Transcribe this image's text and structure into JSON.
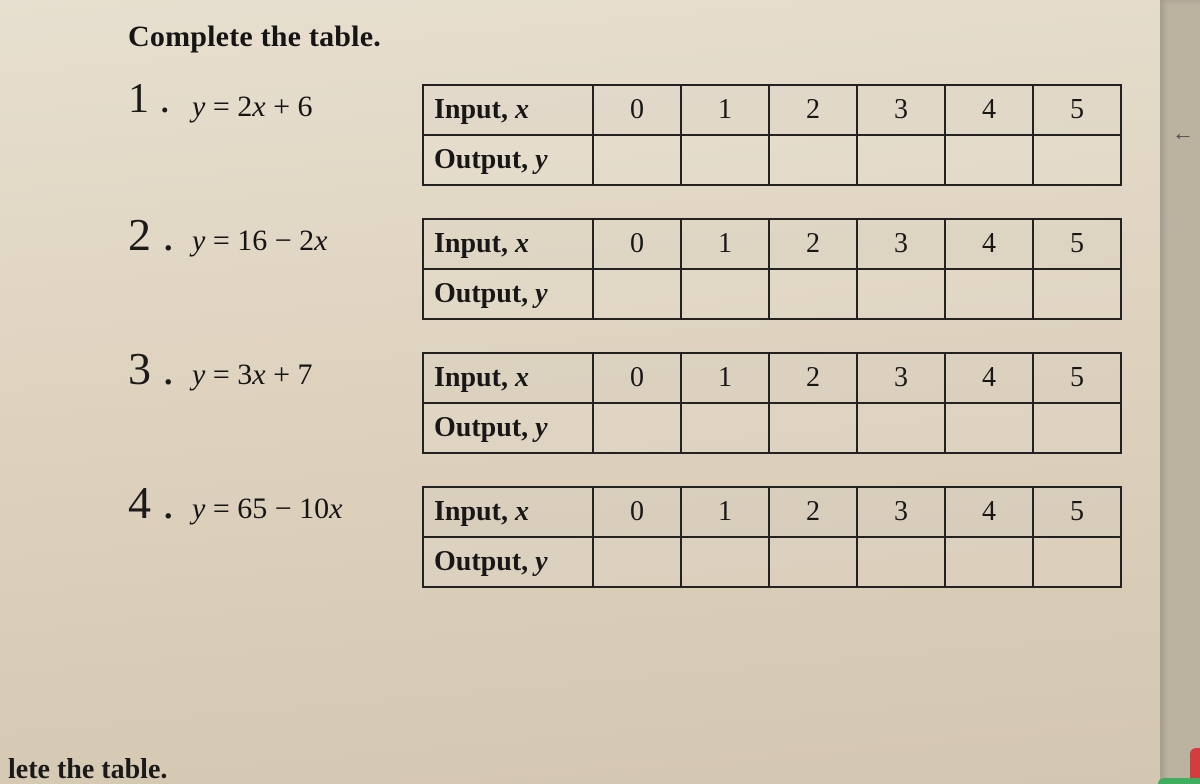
{
  "heading": "Complete the table.",
  "row_labels": {
    "input": "Input, ",
    "input_var": "x",
    "output": "Output, ",
    "output_var": "y"
  },
  "problems": [
    {
      "num": "1 .",
      "eqn_y": "y",
      "eqn_eq": " = 2",
      "eqn_x": "x",
      "eqn_tail": " + 6",
      "inputs": [
        "0",
        "1",
        "2",
        "3",
        "4",
        "5"
      ],
      "outputs": [
        "",
        "",
        "",
        "",
        "",
        ""
      ]
    },
    {
      "num": "2 .",
      "eqn_y": "y",
      "eqn_eq": " = 16 − 2",
      "eqn_x": "x",
      "eqn_tail": "",
      "inputs": [
        "0",
        "1",
        "2",
        "3",
        "4",
        "5"
      ],
      "outputs": [
        "",
        "",
        "",
        "",
        "",
        ""
      ]
    },
    {
      "num": "3 .",
      "eqn_y": "y",
      "eqn_eq": " = 3",
      "eqn_x": "x",
      "eqn_tail": " + 7",
      "inputs": [
        "0",
        "1",
        "2",
        "3",
        "4",
        "5"
      ],
      "outputs": [
        "",
        "",
        "",
        "",
        "",
        ""
      ]
    },
    {
      "num": "4 .",
      "eqn_y": "y",
      "eqn_eq": " = 65 − 10",
      "eqn_x": "x",
      "eqn_tail": "",
      "inputs": [
        "0",
        "1",
        "2",
        "3",
        "4",
        "5"
      ],
      "outputs": [
        "",
        "",
        "",
        "",
        "",
        ""
      ]
    }
  ],
  "arrow_glyph": "←",
  "bottom_cut": "lete the table."
}
